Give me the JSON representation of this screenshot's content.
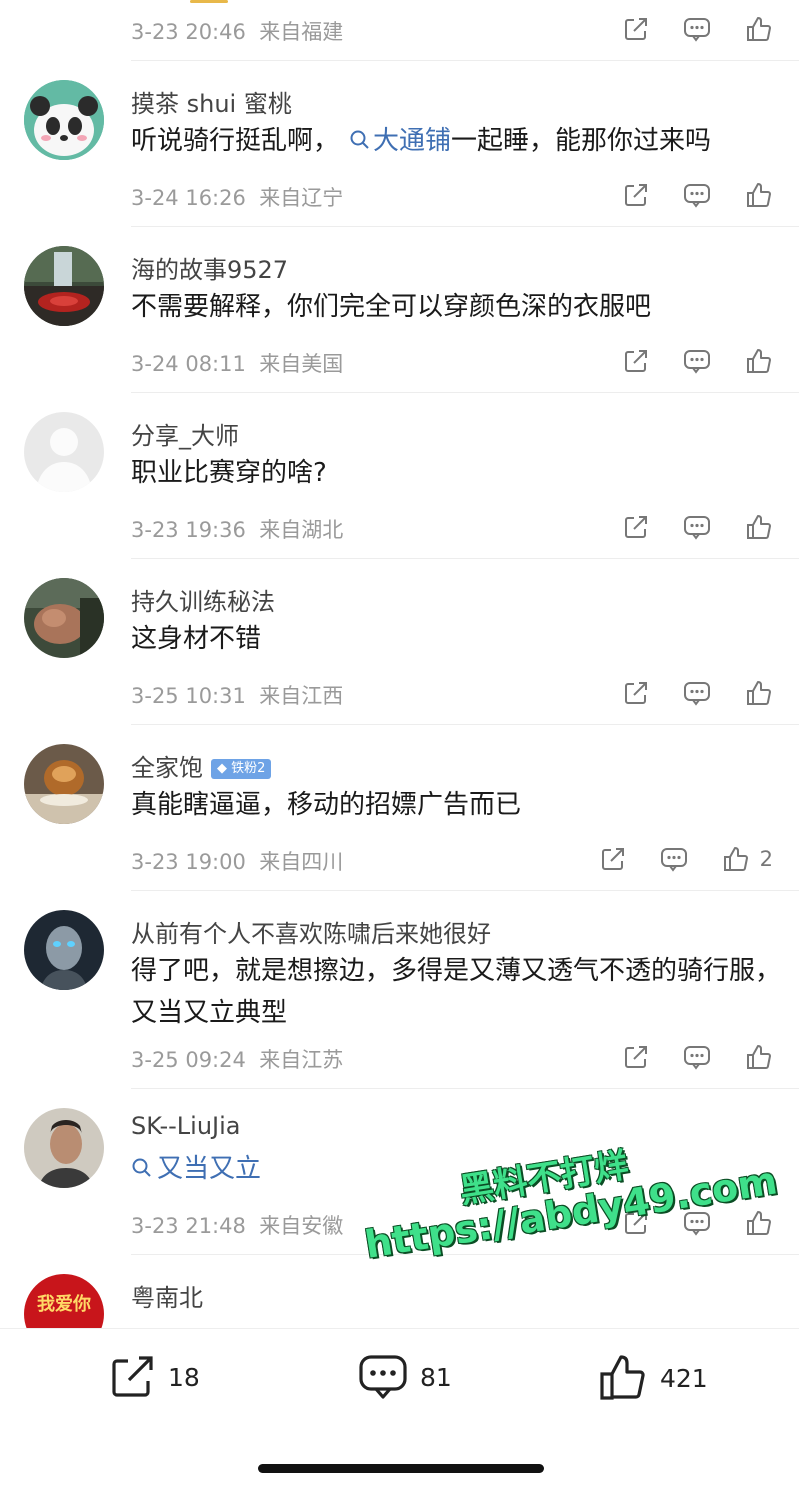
{
  "comments": [
    {
      "user": "",
      "text": "",
      "time": "3-23 20:46",
      "location": "来自福建",
      "likes": ""
    },
    {
      "user": "摸茶 shui 蜜桃",
      "text_before": "听说骑行挺乱啊，",
      "topic": "大通铺",
      "text_after": "一起睡，能那你过来吗",
      "time": "3-24 16:26",
      "location": "来自辽宁",
      "likes": ""
    },
    {
      "user": "海的故事9527",
      "text": "不需要解释，你们完全可以穿颜色深的衣服吧",
      "time": "3-24 08:11",
      "location": "来自美国",
      "likes": ""
    },
    {
      "user": "分享_大师",
      "text": "职业比赛穿的啥?",
      "time": "3-23 19:36",
      "location": "来自湖北",
      "likes": ""
    },
    {
      "user": "持久训练秘法",
      "text": "这身材不错",
      "time": "3-25 10:31",
      "location": "来自江西",
      "likes": ""
    },
    {
      "user": "全家饱",
      "badge": "铁粉2",
      "text": "真能瞎逼逼，移动的招嫖广告而已",
      "time": "3-23 19:00",
      "location": "来自四川",
      "likes": "2"
    },
    {
      "user": "从前有个人不喜欢陈啸后来她很好",
      "text": "得了吧，就是想擦边，多得是又薄又透气不透的骑行服，又当又立典型",
      "time": "3-25 09:24",
      "location": "来自江苏",
      "likes": ""
    },
    {
      "user": "SK--LiuJia",
      "topic": "又当又立",
      "time": "3-23 21:48",
      "location": "来自安徽",
      "likes": ""
    },
    {
      "user": "粤南北",
      "avatar_text": "我爱你",
      "text_partial": "",
      "time": "",
      "location": ""
    }
  ],
  "bottom_bar": {
    "share_count": "18",
    "comment_count": "81",
    "like_count": "421"
  },
  "watermark": {
    "line1": "黑料不打烊",
    "line2": "https://abdy49.com"
  },
  "colors": {
    "topic_link": "#3f6fb3",
    "meta_gray": "#9a9a9a",
    "badge_blue": "#6ea3e6",
    "watermark_green": "#3fe08a"
  }
}
